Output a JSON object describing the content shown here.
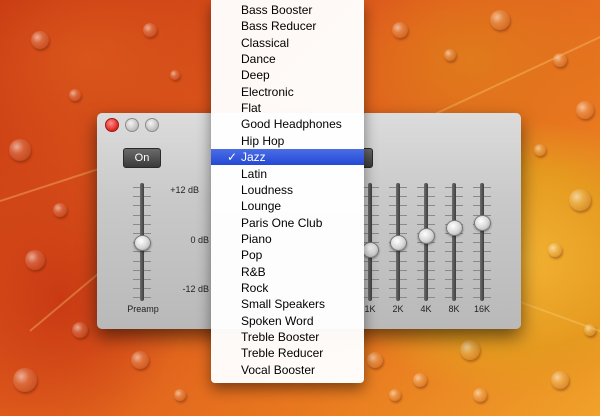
{
  "window": {
    "on_label": "On",
    "db_top": "+12 dB",
    "db_mid": "0 dB",
    "db_bottom": "-12 dB",
    "preamp_label": "Preamp",
    "preamp_level_db": 0,
    "bands": [
      {
        "label": "1K",
        "level_db": -1.5
      },
      {
        "label": "2K",
        "level_db": 0
      },
      {
        "label": "4K",
        "level_db": 1.5
      },
      {
        "label": "8K",
        "level_db": 3.0
      },
      {
        "label": "16K",
        "level_db": 4.0
      }
    ]
  },
  "menu": {
    "items": [
      {
        "label": "Bass Booster",
        "selected": false
      },
      {
        "label": "Bass Reducer",
        "selected": false
      },
      {
        "label": "Classical",
        "selected": false
      },
      {
        "label": "Dance",
        "selected": false
      },
      {
        "label": "Deep",
        "selected": false
      },
      {
        "label": "Electronic",
        "selected": false
      },
      {
        "label": "Flat",
        "selected": false
      },
      {
        "label": "Good Headphones",
        "selected": false
      },
      {
        "label": "Hip Hop",
        "selected": false
      },
      {
        "label": "Jazz",
        "selected": true
      },
      {
        "label": "Latin",
        "selected": false
      },
      {
        "label": "Loudness",
        "selected": false
      },
      {
        "label": "Lounge",
        "selected": false
      },
      {
        "label": "Paris One Club",
        "selected": false
      },
      {
        "label": "Piano",
        "selected": false
      },
      {
        "label": "Pop",
        "selected": false
      },
      {
        "label": "R&B",
        "selected": false
      },
      {
        "label": "Rock",
        "selected": false
      },
      {
        "label": "Small Speakers",
        "selected": false
      },
      {
        "label": "Spoken Word",
        "selected": false
      },
      {
        "label": "Treble Booster",
        "selected": false
      },
      {
        "label": "Treble Reducer",
        "selected": false
      },
      {
        "label": "Vocal Booster",
        "selected": false
      }
    ],
    "check_glyph": "✓"
  }
}
